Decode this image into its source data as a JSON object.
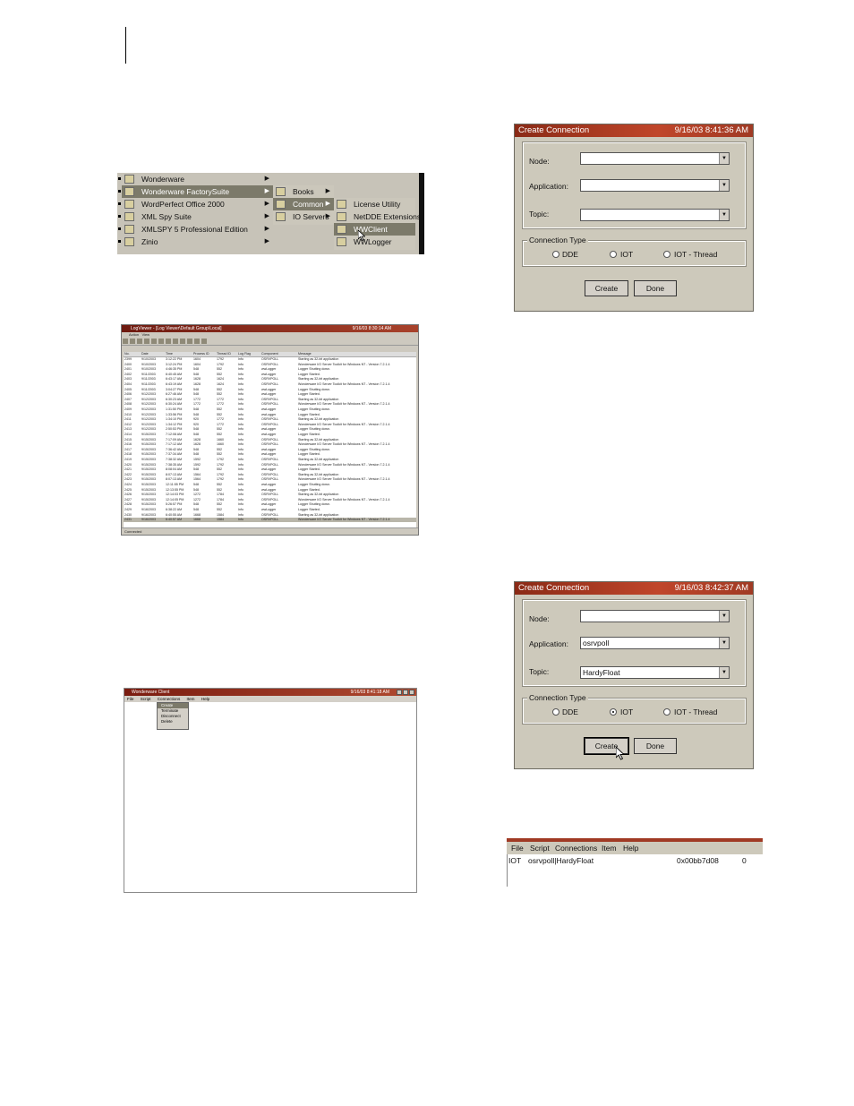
{
  "start_menu": {
    "col1": [
      {
        "label": "Wonderware",
        "selected": false
      },
      {
        "label": "Wonderware FactorySuite",
        "selected": true
      },
      {
        "label": "WordPerfect Office 2000",
        "selected": false
      },
      {
        "label": "XML Spy Suite",
        "selected": false
      },
      {
        "label": "XMLSPY 5 Professional Edition",
        "selected": false
      },
      {
        "label": "Zinio",
        "selected": false
      }
    ],
    "col2": [
      {
        "label": "Books",
        "selected": false
      },
      {
        "label": "Common",
        "selected": true
      },
      {
        "label": "IO Servers",
        "selected": false
      }
    ],
    "col3": [
      {
        "label": "License Utility",
        "selected": false
      },
      {
        "label": "NetDDE Extensions",
        "selected": false
      },
      {
        "label": "WWClient",
        "selected": true
      },
      {
        "label": "WWLogger",
        "selected": false
      }
    ]
  },
  "log_viewer": {
    "title": "LogViewer - [Log Viewer\\Default Group\\Local]",
    "time": "9/16/03 8:30:14 AM",
    "menu": [
      "Action",
      "View"
    ],
    "columns": [
      "No.",
      "Date",
      "Time",
      "Process ID",
      "Thread ID",
      "Log Flag",
      "Component",
      "Message"
    ],
    "rows": [
      [
        "2399",
        "9/10/2003",
        "3:12:22 PM",
        "1604",
        "1792",
        "Info",
        "OSRVPOLL",
        "Starting as 32-bit application"
      ],
      [
        "2400",
        "9/10/2003",
        "3:12:24 PM",
        "1604",
        "1792",
        "Info",
        "OSRVPOLL",
        "Wonderware I/O Server Toolkit for Windows NT - Version 7.2.1.4"
      ],
      [
        "2401",
        "9/10/2003",
        "4:46:35 PM",
        "548",
        "552",
        "Info",
        "wwLogger",
        "Logger Shutting down."
      ],
      [
        "2402",
        "9/11/2003",
        "6:40:45 AM",
        "548",
        "552",
        "Info",
        "wwLogger",
        "Logger Started."
      ],
      [
        "2403",
        "9/11/2003",
        "6:43:17 AM",
        "1628",
        "1624",
        "Info",
        "OSRVPOLL",
        "Starting as 32-bit application"
      ],
      [
        "2404",
        "9/11/2003",
        "6:43:19 AM",
        "1628",
        "1624",
        "Info",
        "OSRVPOLL",
        "Wonderware I/O Server Toolkit for Windows NT - Version 7.2.1.4"
      ],
      [
        "2405",
        "9/11/2003",
        "3:04:27 PM",
        "548",
        "552",
        "Info",
        "wwLogger",
        "Logger Shutting down."
      ],
      [
        "2406",
        "9/12/2003",
        "6:27:46 AM",
        "548",
        "552",
        "Info",
        "wwLogger",
        "Logger Started."
      ],
      [
        "2407",
        "9/12/2003",
        "6:30:23 AM",
        "1772",
        "1772",
        "Info",
        "OSRVPOLL",
        "Starting as 32-bit application"
      ],
      [
        "2408",
        "9/12/2003",
        "6:30:24 AM",
        "1772",
        "1772",
        "Info",
        "OSRVPOLL",
        "Wonderware I/O Server Toolkit for Windows NT - Version 7.2.1.4"
      ],
      [
        "2409",
        "9/12/2003",
        "1:31:50 PM",
        "548",
        "552",
        "Info",
        "wwLogger",
        "Logger Shutting down."
      ],
      [
        "2410",
        "9/12/2003",
        "1:33:56 PM",
        "548",
        "552",
        "Info",
        "wwLogger",
        "Logger Started."
      ],
      [
        "2411",
        "9/12/2003",
        "1:34:10 PM",
        "920",
        "1772",
        "Info",
        "OSRVPOLL",
        "Starting as 32-bit application"
      ],
      [
        "2412",
        "9/12/2003",
        "1:34:12 PM",
        "920",
        "1772",
        "Info",
        "OSRVPOLL",
        "Wonderware I/O Server Toolkit for Windows NT - Version 7.2.1.4"
      ],
      [
        "2413",
        "9/12/2003",
        "2:50:53 PM",
        "548",
        "552",
        "Info",
        "wwLogger",
        "Logger Shutting down."
      ],
      [
        "2414",
        "9/15/2003",
        "7:12:08 AM",
        "548",
        "552",
        "Info",
        "wwLogger",
        "Logger Started."
      ],
      [
        "2415",
        "9/15/2003",
        "7:17:09 AM",
        "1628",
        "1660",
        "Info",
        "OSRVPOLL",
        "Starting as 32-bit application"
      ],
      [
        "2416",
        "9/15/2003",
        "7:17:12 AM",
        "1628",
        "1660",
        "Info",
        "OSRVPOLL",
        "Wonderware I/O Server Toolkit for Windows NT - Version 7.2.1.4"
      ],
      [
        "2417",
        "9/15/2003",
        "7:36:42 AM",
        "548",
        "552",
        "Info",
        "wwLogger",
        "Logger Shutting down."
      ],
      [
        "2418",
        "9/15/2003",
        "7:37:34 AM",
        "548",
        "552",
        "Info",
        "wwLogger",
        "Logger Started."
      ],
      [
        "2419",
        "9/15/2003",
        "7:38:32 AM",
        "1592",
        "1792",
        "Info",
        "OSRVPOLL",
        "Starting as 32-bit application"
      ],
      [
        "2420",
        "9/15/2003",
        "7:38:35 AM",
        "1592",
        "1792",
        "Info",
        "OSRVPOLL",
        "Wonderware I/O Server Toolkit for Windows NT - Version 7.2.1.4"
      ],
      [
        "2421",
        "9/15/2003",
        "8:08:04 AM",
        "548",
        "552",
        "Info",
        "wwLogger",
        "Logger Started."
      ],
      [
        "2422",
        "9/15/2003",
        "8:07:13 AM",
        "1564",
        "1792",
        "Info",
        "OSRVPOLL",
        "Starting as 32-bit application"
      ],
      [
        "2423",
        "9/15/2003",
        "8:07:13 AM",
        "1564",
        "1792",
        "Info",
        "OSRVPOLL",
        "Wonderware I/O Server Toolkit for Windows NT - Version 7.2.1.4"
      ],
      [
        "2424",
        "9/15/2003",
        "12:11:55 PM",
        "548",
        "552",
        "Info",
        "wwLogger",
        "Logger Shutting down."
      ],
      [
        "2425",
        "9/15/2003",
        "12:13:55 PM",
        "548",
        "552",
        "Info",
        "wwLogger",
        "Logger Started."
      ],
      [
        "2426",
        "9/15/2003",
        "12:14:03 PM",
        "1272",
        "1784",
        "Info",
        "OSRVPOLL",
        "Starting as 32-bit application"
      ],
      [
        "2427",
        "9/15/2003",
        "12:14:05 PM",
        "1272",
        "1784",
        "Info",
        "OSRVPOLL",
        "Wonderware I/O Server Toolkit for Windows NT - Version 7.2.1.4"
      ],
      [
        "2428",
        "9/15/2003",
        "5:26:57 PM",
        "548",
        "552",
        "Info",
        "wwLogger",
        "Logger Shutting down."
      ],
      [
        "2429",
        "9/16/2003",
        "6:38:22 AM",
        "548",
        "552",
        "Info",
        "wwLogger",
        "Logger Started."
      ],
      [
        "2430",
        "9/16/2003",
        "6:40:55 AM",
        "1668",
        "1584",
        "Info",
        "OSRVPOLL",
        "Starting as 32-bit application"
      ],
      [
        "2431",
        "9/16/2003",
        "6:40:57 AM",
        "1668",
        "1584",
        "Info",
        "OSRVPOLL",
        "Wonderware I/O Server Toolkit for Windows NT - Version 7.2.1.4"
      ]
    ],
    "status": "Connected"
  },
  "ww_client": {
    "title": "Wonderware Client",
    "time": "9/16/03 8:41:18 AM",
    "menu": [
      "File",
      "Script",
      "Connections",
      "Item",
      "Help"
    ],
    "dropdown": [
      "Create",
      "Terminate",
      "Disconnect",
      "Delete"
    ]
  },
  "dialog1": {
    "title": "Create Connection",
    "time": "9/16/03 8:41:36 AM",
    "node_label": "Node:",
    "application_label": "Application:",
    "topic_label": "Topic:",
    "node_value": "",
    "application_value": "",
    "topic_value": "",
    "group_label": "Connection Type",
    "radio_dde": "DDE",
    "radio_iot": "IOT",
    "radio_iot_thread": "IOT - Thread",
    "selected": "none",
    "create_label": "Create",
    "done_label": "Done"
  },
  "dialog2": {
    "title": "Create Connection",
    "time": "9/16/03 8:42:37 AM",
    "node_label": "Node:",
    "application_label": "Application:",
    "topic_label": "Topic:",
    "node_value": "",
    "application_value": "osrvpoll",
    "topic_value": "HardyFloat",
    "group_label": "Connection Type",
    "radio_dde": "DDE",
    "radio_iot": "IOT",
    "radio_iot_thread": "IOT - Thread",
    "selected": "IOT",
    "create_label": "Create",
    "done_label": "Done"
  },
  "result_list": {
    "menu": [
      "File",
      "Script",
      "Connections",
      "Item",
      "Help"
    ],
    "row": {
      "type": "IOT",
      "connection": "osrvpoll|HardyFloat",
      "handle": "0x00bb7d08",
      "count": "0"
    }
  }
}
